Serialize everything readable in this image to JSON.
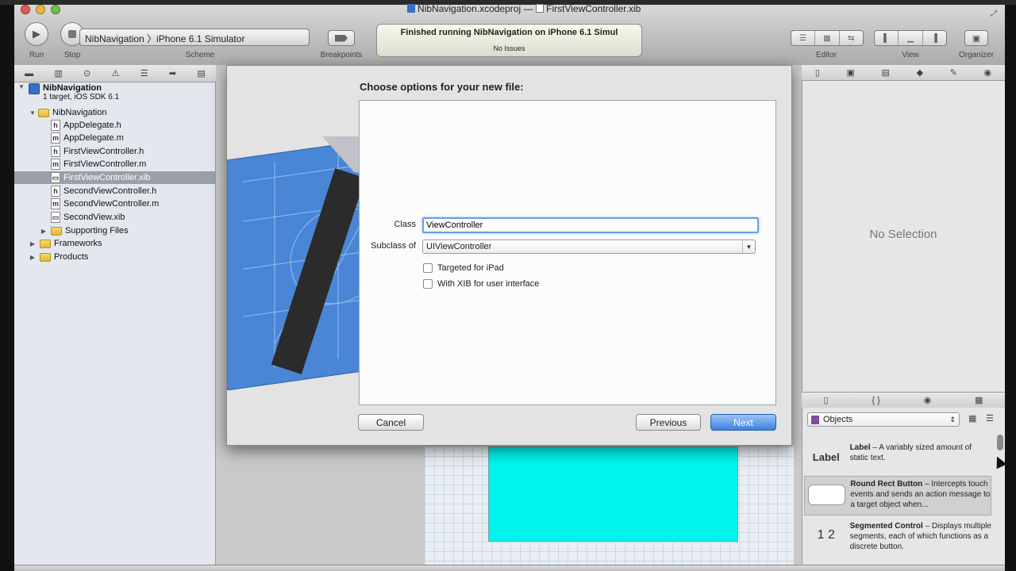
{
  "window": {
    "title_project": "NibNavigation.xcodeproj",
    "title_separator": "—",
    "title_file": "FirstViewController.xib"
  },
  "toolbar": {
    "run_label": "Run",
    "stop_label": "Stop",
    "scheme_value": "NibNavigation 〉iPhone 6.1 Simulator",
    "scheme_label": "Scheme",
    "breakpoints_label": "Breakpoints",
    "activity_status": "Finished running NibNavigation on iPhone 6.1 Simul",
    "activity_issues": "No Issues",
    "editor_label": "Editor",
    "view_label": "View",
    "organizer_label": "Organizer"
  },
  "navigator": {
    "project_name": "NibNavigation",
    "project_sub": "1 target, iOS SDK 6.1",
    "items": [
      {
        "label": "NibNavigation",
        "kind": "folder"
      },
      {
        "label": "AppDelegate.h",
        "kind": "h"
      },
      {
        "label": "AppDelegate.m",
        "kind": "m"
      },
      {
        "label": "FirstViewController.h",
        "kind": "h"
      },
      {
        "label": "FirstViewController.m",
        "kind": "m"
      },
      {
        "label": "FirstViewController.xib",
        "kind": "xib"
      },
      {
        "label": "SecondViewController.h",
        "kind": "h"
      },
      {
        "label": "SecondViewController.m",
        "kind": "m"
      },
      {
        "label": "SecondView.xib",
        "kind": "xib"
      },
      {
        "label": "Supporting Files",
        "kind": "folder"
      },
      {
        "label": "Frameworks",
        "kind": "folder"
      },
      {
        "label": "Products",
        "kind": "folder"
      }
    ]
  },
  "sheet": {
    "title": "Choose options for your new file:",
    "class_label": "Class",
    "class_value": "ViewController",
    "subclass_label": "Subclass of",
    "subclass_value": "UIViewController",
    "ipad_label": "Targeted for iPad",
    "xib_label": "With XIB for user interface",
    "cancel_label": "Cancel",
    "previous_label": "Previous",
    "next_label": "Next"
  },
  "inspector": {
    "no_selection": "No Selection"
  },
  "library": {
    "selector_value": "Objects",
    "items": [
      {
        "thumb": "Label",
        "name": "Label",
        "desc": " – A variably sized amount of static text."
      },
      {
        "thumb": "",
        "name": "Round Rect Button",
        "desc": " – Intercepts touch events and sends an action message to a target object when..."
      },
      {
        "thumb": "1 2",
        "name": "Segmented Control",
        "desc": " – Displays multiple segments, each of which functions as a discrete button."
      }
    ]
  },
  "colors": {
    "accent_blue": "#3c82e0",
    "cyan_view": "#00f4ee",
    "focus_ring": "#6a9ee6"
  }
}
